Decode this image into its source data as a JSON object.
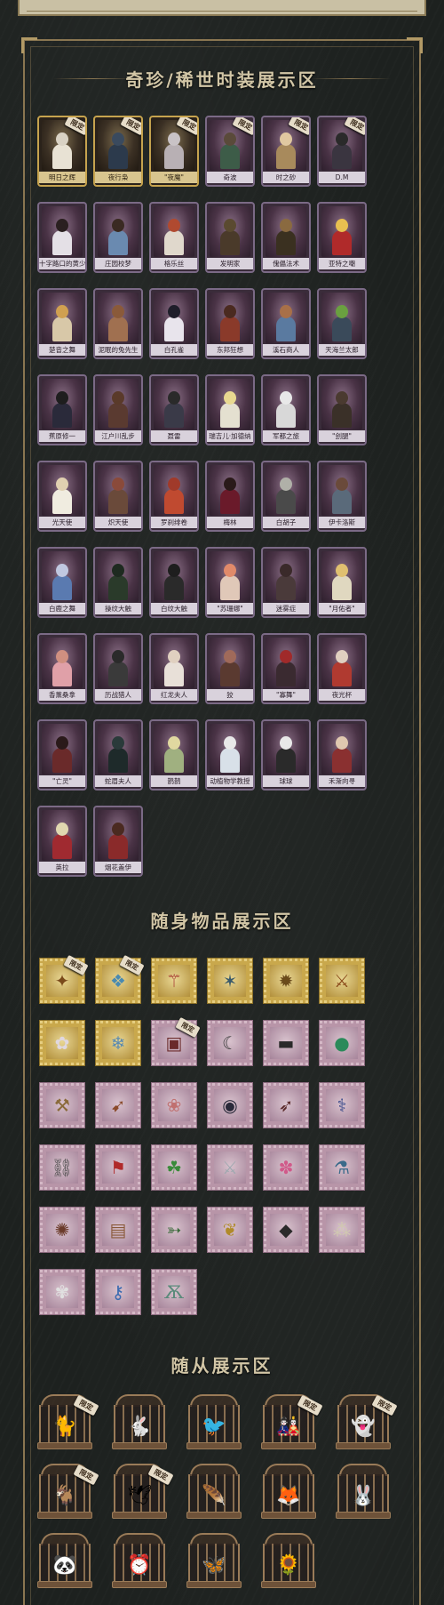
{
  "sections": {
    "costumes_title": "奇珍/稀世时装展示区",
    "accessories_title": "随身物品展示区",
    "pets_title": "随从展示区"
  },
  "limited_tag": "限定",
  "costumes": [
    {
      "name": "明日之辉",
      "gold": true,
      "limited": true,
      "head": "#d9d2c4",
      "body": "#e8e2d4"
    },
    {
      "name": "夜行枭",
      "gold": true,
      "limited": true,
      "head": "#3a4a5e",
      "body": "#2c3a4c"
    },
    {
      "name": "\"夜魔\"",
      "gold": true,
      "limited": true,
      "head": "#c9c3c6",
      "body": "#b8b0b4"
    },
    {
      "name": "奇波",
      "gold": false,
      "limited": true,
      "head": "#5a4a3a",
      "body": "#3d5c48"
    },
    {
      "name": "时之砂",
      "gold": false,
      "limited": true,
      "head": "#e0c8a0",
      "body": "#a88a5c"
    },
    {
      "name": "D.M",
      "gold": false,
      "limited": true,
      "head": "#2a2a2a",
      "body": "#3a3540"
    },
    {
      "name": "十字路口的黄少年",
      "gold": false,
      "limited": false,
      "head": "#2a2020",
      "body": "#e4e0e6"
    },
    {
      "name": "庄园校梦",
      "gold": false,
      "limited": false,
      "head": "#3a2a22",
      "body": "#6a8ab0"
    },
    {
      "name": "格乐丝",
      "gold": false,
      "limited": false,
      "head": "#b04a30",
      "body": "#e0d8cc"
    },
    {
      "name": "发明家",
      "gold": false,
      "limited": false,
      "head": "#5a4a30",
      "body": "#4a3a2a"
    },
    {
      "name": "傀儡法术",
      "gold": false,
      "limited": false,
      "head": "#8a6a40",
      "body": "#3a3020"
    },
    {
      "name": "亚特之嘲",
      "gold": false,
      "limited": false,
      "head": "#e8c050",
      "body": "#b02a2a"
    },
    {
      "name": "楚音之舞",
      "gold": false,
      "limited": false,
      "head": "#d0a050",
      "body": "#d8c8a8"
    },
    {
      "name": "泥眠的兔先生",
      "gold": false,
      "limited": false,
      "head": "#8a5a3a",
      "body": "#a07050"
    },
    {
      "name": "白孔雀",
      "gold": false,
      "limited": false,
      "head": "#1e1e2a",
      "body": "#e8e4ec"
    },
    {
      "name": "东邦狂想",
      "gold": false,
      "limited": false,
      "head": "#4a2a20",
      "body": "#8a3a2a"
    },
    {
      "name": "溪石商人",
      "gold": false,
      "limited": false,
      "head": "#a87048",
      "body": "#5a7aa0"
    },
    {
      "name": "天海兰太郎",
      "gold": false,
      "limited": false,
      "head": "#6aa040",
      "body": "#3a4a5a"
    },
    {
      "name": "蕉原修一",
      "gold": false,
      "limited": false,
      "head": "#1e1e1e",
      "body": "#2a2a3a"
    },
    {
      "name": "江户川乱步",
      "gold": false,
      "limited": false,
      "head": "#5a3a2a",
      "body": "#5a3a30"
    },
    {
      "name": "聂雷",
      "gold": false,
      "limited": false,
      "head": "#2a2a2a",
      "body": "#3a3a48"
    },
    {
      "name": "瑞吉儿·加德纳",
      "gold": false,
      "limited": false,
      "head": "#e8d890",
      "body": "#e4e0d0"
    },
    {
      "name": "军都之旅",
      "gold": false,
      "limited": false,
      "head": "#e8e8e8",
      "body": "#d8d8d8"
    },
    {
      "name": "\"刽腿\"",
      "gold": false,
      "limited": false,
      "head": "#4a3a30",
      "body": "#3a3028"
    },
    {
      "name": "光天使",
      "gold": false,
      "limited": false,
      "head": "#e0d0b0",
      "body": "#f0ece0"
    },
    {
      "name": "炽天使",
      "gold": false,
      "limited": false,
      "head": "#8a4a3a",
      "body": "#6a4a3a"
    },
    {
      "name": "罗刹绯卷",
      "gold": false,
      "limited": false,
      "head": "#a03a2a",
      "body": "#c04a30"
    },
    {
      "name": "梅林",
      "gold": false,
      "limited": false,
      "head": "#2a1a1a",
      "body": "#6a1a2a"
    },
    {
      "name": "白胡子",
      "gold": false,
      "limited": false,
      "head": "#b0b0a8",
      "body": "#4a4a4a"
    },
    {
      "name": "伊卡洛斯",
      "gold": false,
      "limited": false,
      "head": "#6a4a3a",
      "body": "#5a6a7a"
    },
    {
      "name": "白鹿之舞",
      "gold": false,
      "limited": false,
      "head": "#c0c8e0",
      "body": "#5a7ab0"
    },
    {
      "name": "操纹大触",
      "gold": false,
      "limited": false,
      "head": "#1e2a20",
      "body": "#2a3a2a"
    },
    {
      "name": "白纹大触",
      "gold": false,
      "limited": false,
      "head": "#1e1e1e",
      "body": "#2a2a2a"
    },
    {
      "name": "\"苏珊娜\"",
      "gold": false,
      "limited": false,
      "head": "#e08a6a",
      "body": "#e0c8b8"
    },
    {
      "name": "迷雾症",
      "gold": false,
      "limited": false,
      "head": "#3a2a2a",
      "body": "#4a3a3a"
    },
    {
      "name": "\"月佑者\"",
      "gold": false,
      "limited": false,
      "head": "#e0c070",
      "body": "#e0d8c0"
    },
    {
      "name": "香薰桑拿",
      "gold": false,
      "limited": false,
      "head": "#d09080",
      "body": "#e0a0a8"
    },
    {
      "name": "历战猎人",
      "gold": false,
      "limited": false,
      "head": "#2a2a2a",
      "body": "#3a3a3a"
    },
    {
      "name": "红龙夫人",
      "gold": false,
      "limited": false,
      "head": "#e0d0c0",
      "body": "#e8e0d8"
    },
    {
      "name": "狡",
      "gold": false,
      "limited": false,
      "head": "#a06a5a",
      "body": "#5a3a30"
    },
    {
      "name": "\"寡舞\"",
      "gold": false,
      "limited": false,
      "head": "#a02a2a",
      "body": "#3a2a30"
    },
    {
      "name": "夜光杯",
      "gold": false,
      "limited": false,
      "head": "#e0d0c0",
      "body": "#b03a30"
    },
    {
      "name": "\"亡灵\"",
      "gold": false,
      "limited": false,
      "head": "#2a1a1a",
      "body": "#6a2a2a"
    },
    {
      "name": "蛇眉夫人",
      "gold": false,
      "limited": false,
      "head": "#2a3a3a",
      "body": "#1e2a2a"
    },
    {
      "name": "鹊鹊",
      "gold": false,
      "limited": false,
      "head": "#e0d8a0",
      "body": "#a0b080"
    },
    {
      "name": "动植物学教授",
      "gold": false,
      "limited": false,
      "head": "#e8e8e8",
      "body": "#d8e0e8"
    },
    {
      "name": "球球",
      "gold": false,
      "limited": false,
      "head": "#e8e8e8",
      "body": "#2a2a2a"
    },
    {
      "name": "禾渐向寻",
      "gold": false,
      "limited": false,
      "head": "#e0c8b0",
      "body": "#8a3030"
    },
    {
      "name": "英拉",
      "gold": false,
      "limited": false,
      "head": "#e0d8b0",
      "body": "#a02a30"
    },
    {
      "name": "烟花盖伊",
      "gold": false,
      "limited": false,
      "head": "#4a2a20",
      "body": "#8a2a2a"
    }
  ],
  "accessories": [
    {
      "icon": "treasure-chest-icon",
      "glyph": "✦",
      "gold": true,
      "limited": true,
      "color": "#7a4a1a"
    },
    {
      "icon": "crystal-bird-icon",
      "glyph": "❖",
      "gold": true,
      "limited": true,
      "color": "#4a8ab0"
    },
    {
      "icon": "staff-icon",
      "glyph": "⚚",
      "gold": true,
      "limited": false,
      "color": "#a02a2a"
    },
    {
      "icon": "dragon-claw-icon",
      "glyph": "✶",
      "gold": true,
      "limited": false,
      "color": "#3a5a6a"
    },
    {
      "icon": "beetle-icon",
      "glyph": "✹",
      "gold": true,
      "limited": false,
      "color": "#6a4a1a"
    },
    {
      "icon": "scepter-icon",
      "glyph": "⚔",
      "gold": true,
      "limited": false,
      "color": "#8a4a1a"
    },
    {
      "icon": "flower-icon",
      "glyph": "✿",
      "gold": true,
      "limited": false,
      "color": "#e0d8e0"
    },
    {
      "icon": "ice-crystal-icon",
      "glyph": "❄",
      "gold": true,
      "limited": false,
      "color": "#5a8ab0"
    },
    {
      "icon": "card-icon",
      "glyph": "▣",
      "gold": false,
      "limited": true,
      "color": "#6a2a2a"
    },
    {
      "icon": "hook-icon",
      "glyph": "☾",
      "gold": false,
      "limited": false,
      "color": "#3a3a3a"
    },
    {
      "icon": "tape-icon",
      "glyph": "▬",
      "gold": false,
      "limited": false,
      "color": "#2a2a2a"
    },
    {
      "icon": "green-orb-icon",
      "glyph": "●",
      "gold": false,
      "limited": false,
      "color": "#2a8a5a"
    },
    {
      "icon": "hammer-icon",
      "glyph": "⚒",
      "gold": false,
      "limited": false,
      "color": "#8a6a3a"
    },
    {
      "icon": "feather-icon",
      "glyph": "➹",
      "gold": false,
      "limited": false,
      "color": "#8a4a2a"
    },
    {
      "icon": "cake-icon",
      "glyph": "❀",
      "gold": false,
      "limited": false,
      "color": "#c07070"
    },
    {
      "icon": "black-hole-icon",
      "glyph": "◉",
      "gold": false,
      "limited": false,
      "color": "#2a2a3a"
    },
    {
      "icon": "horn-icon",
      "glyph": "➶",
      "gold": false,
      "limited": false,
      "color": "#5a2a2a"
    },
    {
      "icon": "wand-icon",
      "glyph": "⚕",
      "gold": false,
      "limited": false,
      "color": "#3a4a8a"
    },
    {
      "icon": "lantern-icon",
      "glyph": "⛓",
      "gold": false,
      "limited": false,
      "color": "#4a4a4a"
    },
    {
      "icon": "banner-icon",
      "glyph": "⚑",
      "gold": false,
      "limited": false,
      "color": "#b02a2a"
    },
    {
      "icon": "clover-icon",
      "glyph": "☘",
      "gold": false,
      "limited": false,
      "color": "#3a8a3a"
    },
    {
      "icon": "sword-icon",
      "glyph": "⚔",
      "gold": false,
      "limited": false,
      "color": "#a0a8b0"
    },
    {
      "icon": "sweets-icon",
      "glyph": "✽",
      "gold": false,
      "limited": false,
      "color": "#d05a8a"
    },
    {
      "icon": "syringe-icon",
      "glyph": "⚗",
      "gold": false,
      "limited": false,
      "color": "#3a6a8a"
    },
    {
      "icon": "mace-icon",
      "glyph": "✺",
      "gold": false,
      "limited": false,
      "color": "#6a3a2a"
    },
    {
      "icon": "scroll-icon",
      "glyph": "▤",
      "gold": false,
      "limited": false,
      "color": "#8a5a3a"
    },
    {
      "icon": "arrow-icon",
      "glyph": "➳",
      "gold": false,
      "limited": false,
      "color": "#3a6a3a"
    },
    {
      "icon": "golden-wing-icon",
      "glyph": "❦",
      "gold": false,
      "limited": false,
      "color": "#b08a2a"
    },
    {
      "icon": "dark-stone-icon",
      "glyph": "◆",
      "gold": false,
      "limited": false,
      "color": "#2a2a2a"
    },
    {
      "icon": "pearl-string-icon",
      "glyph": "⁂",
      "gold": false,
      "limited": false,
      "color": "#d0c8b0"
    },
    {
      "icon": "bouquet-icon",
      "glyph": "✾",
      "gold": false,
      "limited": false,
      "color": "#e0e0e0"
    },
    {
      "icon": "blue-key-icon",
      "glyph": "⚷",
      "gold": false,
      "limited": false,
      "color": "#3a6ab0"
    },
    {
      "icon": "butterfly-icon",
      "glyph": "Ѫ",
      "gold": false,
      "limited": false,
      "color": "#5a8a7a"
    }
  ],
  "pets": [
    {
      "icon": "black-cat-pet-icon",
      "glyph": "🐈",
      "limited": true
    },
    {
      "icon": "pink-bunny-pet-icon",
      "glyph": "🐇",
      "limited": false
    },
    {
      "icon": "dark-bird-pet-icon",
      "glyph": "🐦",
      "limited": false
    },
    {
      "icon": "plague-doll-pet-icon",
      "glyph": "🎎",
      "limited": true
    },
    {
      "icon": "white-ghost-pet-icon",
      "glyph": "👻",
      "limited": true
    },
    {
      "icon": "goat-pet-icon",
      "glyph": "🐐",
      "limited": true
    },
    {
      "icon": "white-dove-pet-icon",
      "glyph": "🕊",
      "limited": true
    },
    {
      "icon": "golden-feather-pet-icon",
      "glyph": "🪶",
      "limited": false
    },
    {
      "icon": "fox-pet-icon",
      "glyph": "🦊",
      "limited": false
    },
    {
      "icon": "crowned-bunny-pet-icon",
      "glyph": "🐰",
      "limited": false
    },
    {
      "icon": "panda-pet-icon",
      "glyph": "🐼",
      "limited": false
    },
    {
      "icon": "golden-clock-pet-icon",
      "glyph": "⏰",
      "limited": false
    },
    {
      "icon": "blue-butterfly-pet-icon",
      "glyph": "🦋",
      "limited": false
    },
    {
      "icon": "sunflower-pet-icon",
      "glyph": "🌻",
      "limited": false
    }
  ]
}
